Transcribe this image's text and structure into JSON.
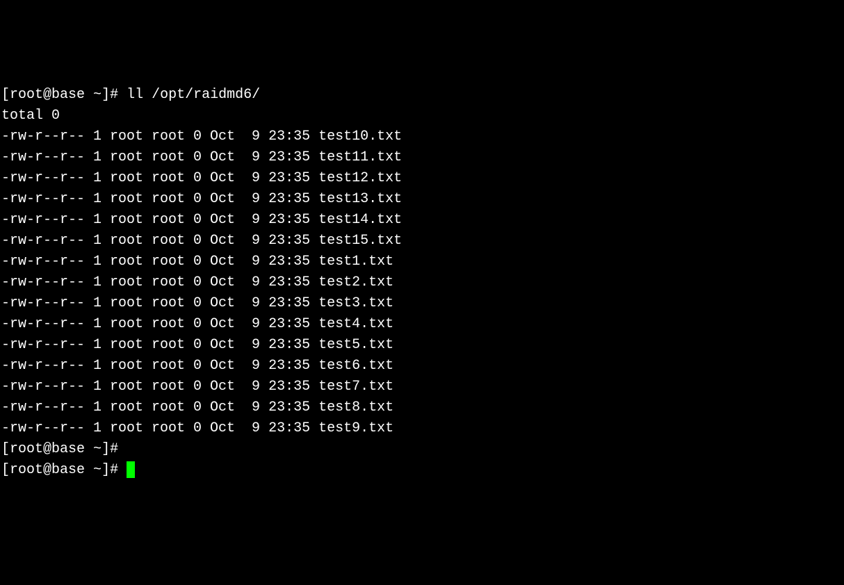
{
  "prompt": {
    "open_bracket": "[",
    "user_host": "root@base",
    "tilde": " ~",
    "close_bracket": "]",
    "hash": "# "
  },
  "command": "ll /opt/raidmd6/",
  "total_line": "total 0",
  "files": [
    {
      "perms": "-rw-r--r--",
      "links": "1",
      "owner": "root",
      "group": "root",
      "size": "0",
      "month": "Oct",
      "day": " 9",
      "time": "23:35",
      "name": "test10.txt"
    },
    {
      "perms": "-rw-r--r--",
      "links": "1",
      "owner": "root",
      "group": "root",
      "size": "0",
      "month": "Oct",
      "day": " 9",
      "time": "23:35",
      "name": "test11.txt"
    },
    {
      "perms": "-rw-r--r--",
      "links": "1",
      "owner": "root",
      "group": "root",
      "size": "0",
      "month": "Oct",
      "day": " 9",
      "time": "23:35",
      "name": "test12.txt"
    },
    {
      "perms": "-rw-r--r--",
      "links": "1",
      "owner": "root",
      "group": "root",
      "size": "0",
      "month": "Oct",
      "day": " 9",
      "time": "23:35",
      "name": "test13.txt"
    },
    {
      "perms": "-rw-r--r--",
      "links": "1",
      "owner": "root",
      "group": "root",
      "size": "0",
      "month": "Oct",
      "day": " 9",
      "time": "23:35",
      "name": "test14.txt"
    },
    {
      "perms": "-rw-r--r--",
      "links": "1",
      "owner": "root",
      "group": "root",
      "size": "0",
      "month": "Oct",
      "day": " 9",
      "time": "23:35",
      "name": "test15.txt"
    },
    {
      "perms": "-rw-r--r--",
      "links": "1",
      "owner": "root",
      "group": "root",
      "size": "0",
      "month": "Oct",
      "day": " 9",
      "time": "23:35",
      "name": "test1.txt"
    },
    {
      "perms": "-rw-r--r--",
      "links": "1",
      "owner": "root",
      "group": "root",
      "size": "0",
      "month": "Oct",
      "day": " 9",
      "time": "23:35",
      "name": "test2.txt"
    },
    {
      "perms": "-rw-r--r--",
      "links": "1",
      "owner": "root",
      "group": "root",
      "size": "0",
      "month": "Oct",
      "day": " 9",
      "time": "23:35",
      "name": "test3.txt"
    },
    {
      "perms": "-rw-r--r--",
      "links": "1",
      "owner": "root",
      "group": "root",
      "size": "0",
      "month": "Oct",
      "day": " 9",
      "time": "23:35",
      "name": "test4.txt"
    },
    {
      "perms": "-rw-r--r--",
      "links": "1",
      "owner": "root",
      "group": "root",
      "size": "0",
      "month": "Oct",
      "day": " 9",
      "time": "23:35",
      "name": "test5.txt"
    },
    {
      "perms": "-rw-r--r--",
      "links": "1",
      "owner": "root",
      "group": "root",
      "size": "0",
      "month": "Oct",
      "day": " 9",
      "time": "23:35",
      "name": "test6.txt"
    },
    {
      "perms": "-rw-r--r--",
      "links": "1",
      "owner": "root",
      "group": "root",
      "size": "0",
      "month": "Oct",
      "day": " 9",
      "time": "23:35",
      "name": "test7.txt"
    },
    {
      "perms": "-rw-r--r--",
      "links": "1",
      "owner": "root",
      "group": "root",
      "size": "0",
      "month": "Oct",
      "day": " 9",
      "time": "23:35",
      "name": "test8.txt"
    },
    {
      "perms": "-rw-r--r--",
      "links": "1",
      "owner": "root",
      "group": "root",
      "size": "0",
      "month": "Oct",
      "day": " 9",
      "time": "23:35",
      "name": "test9.txt"
    }
  ]
}
